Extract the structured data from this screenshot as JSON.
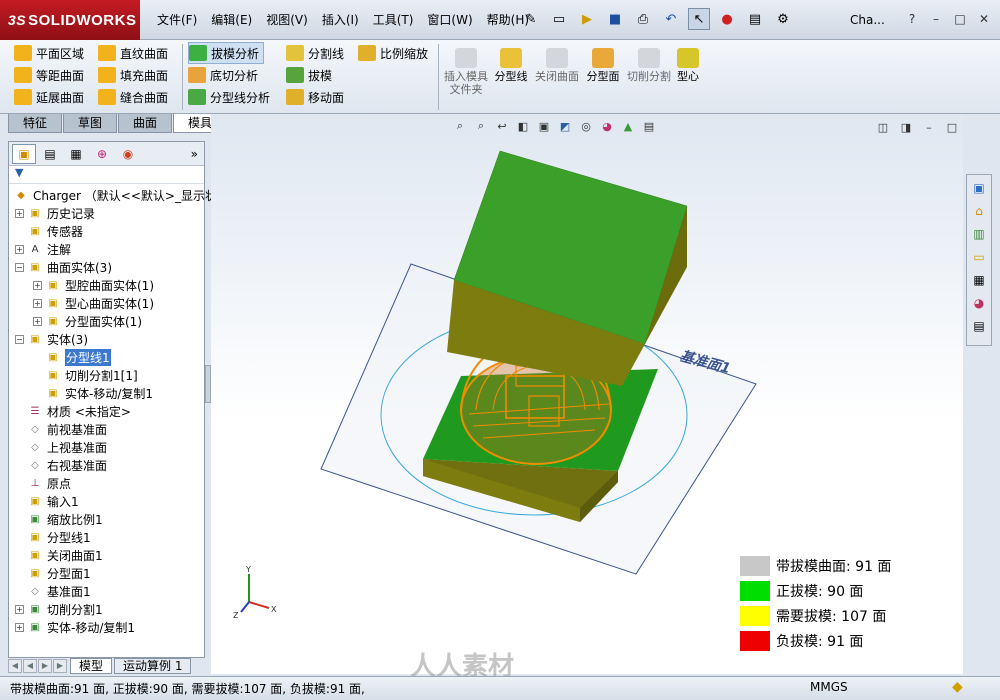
{
  "app": {
    "logo_prefix": "3S",
    "logo_text": "SOLIDWORKS",
    "doc_name": "Cha..."
  },
  "menus": [
    "文件(F)",
    "编辑(E)",
    "视图(V)",
    "插入(I)",
    "工具(T)",
    "窗口(W)",
    "帮助(H)"
  ],
  "window_controls": [
    "–",
    "□",
    "✕"
  ],
  "command_manager": {
    "group1": [
      "平面区域",
      "等距曲面",
      "延展曲面"
    ],
    "group2": [
      "直纹曲面",
      "填充曲面",
      "缝合曲面"
    ],
    "group3": [
      "拔模分析",
      "底切分析",
      "分型线分析"
    ],
    "group4": [
      "分割线",
      "拔模",
      "移动面"
    ],
    "group5": [
      "比例缩放"
    ],
    "big_buttons": [
      {
        "label": "插入模具文件夹",
        "enabled": false
      },
      {
        "label": "分型线",
        "enabled": true
      },
      {
        "label": "关闭曲面",
        "enabled": false
      },
      {
        "label": "分型面",
        "enabled": true
      },
      {
        "label": "切削分割",
        "enabled": false
      },
      {
        "label": "型心",
        "enabled": true
      }
    ]
  },
  "cmd_tabs": [
    "特征",
    "草图",
    "曲面",
    "模具工具"
  ],
  "feature_tree": {
    "expand_glyph": "»",
    "filter_icon": "filter-icon",
    "root": "Charger （默认<<默认>_显示状",
    "nodes": [
      {
        "label": "历史记录",
        "indent": 0,
        "exp": "+",
        "icon": "folder-history-icon"
      },
      {
        "label": "传感器",
        "indent": 0,
        "exp": "",
        "icon": "sensor-icon"
      },
      {
        "label": "注解",
        "indent": 0,
        "exp": "+",
        "icon": "annotation-icon"
      },
      {
        "label": "曲面实体(3)",
        "indent": 0,
        "exp": "−",
        "icon": "surface-bodies-icon"
      },
      {
        "label": "型腔曲面实体(1)",
        "indent": 1,
        "exp": "+",
        "icon": "surface-body-icon"
      },
      {
        "label": "型心曲面实体(1)",
        "indent": 1,
        "exp": "+",
        "icon": "surface-body-icon"
      },
      {
        "label": "分型面实体(1)",
        "indent": 1,
        "exp": "+",
        "icon": "surface-body-icon"
      },
      {
        "label": "实体(3)",
        "indent": 0,
        "exp": "−",
        "icon": "solid-bodies-icon"
      },
      {
        "label": "分型线1",
        "indent": 1,
        "exp": "",
        "icon": "solid-body-icon",
        "selected": true
      },
      {
        "label": "切削分割1[1]",
        "indent": 1,
        "exp": "",
        "icon": "solid-body-icon"
      },
      {
        "label": "实体-移动/复制1",
        "indent": 1,
        "exp": "",
        "icon": "solid-body-icon"
      },
      {
        "label": "材质 <未指定>",
        "indent": 0,
        "exp": "",
        "icon": "material-icon"
      },
      {
        "label": "前视基准面",
        "indent": 0,
        "exp": "",
        "icon": "plane-icon"
      },
      {
        "label": "上视基准面",
        "indent": 0,
        "exp": "",
        "icon": "plane-icon"
      },
      {
        "label": "右视基准面",
        "indent": 0,
        "exp": "",
        "icon": "plane-icon"
      },
      {
        "label": "原点",
        "indent": 0,
        "exp": "",
        "icon": "origin-icon"
      },
      {
        "label": "输入1",
        "indent": 0,
        "exp": "",
        "icon": "import-icon"
      },
      {
        "label": "缩放比例1",
        "indent": 0,
        "exp": "",
        "icon": "scale-icon"
      },
      {
        "label": "分型线1",
        "indent": 0,
        "exp": "",
        "icon": "parting-line-icon"
      },
      {
        "label": "关闭曲面1",
        "indent": 0,
        "exp": "",
        "icon": "shut-off-surface-icon"
      },
      {
        "label": "分型面1",
        "indent": 0,
        "exp": "",
        "icon": "parting-surface-icon"
      },
      {
        "label": "基准面1",
        "indent": 0,
        "exp": "",
        "icon": "plane-icon"
      },
      {
        "label": "切削分割1",
        "indent": 0,
        "exp": "+",
        "icon": "tooling-split-icon"
      },
      {
        "label": "实体-移动/复制1",
        "indent": 0,
        "exp": "+",
        "icon": "move-copy-icon"
      }
    ]
  },
  "model_tabs": [
    "模型",
    "运动算例 1"
  ],
  "graphics": {
    "plane_label": "基准面1",
    "colors": {
      "green": "#1f9a1f",
      "olive": "#7d7d0f",
      "orange": "#f08c00"
    }
  },
  "legend": [
    {
      "label": "带拔模曲面: 91 面",
      "color": "#c8c8c8"
    },
    {
      "label": "正拔模: 90 面",
      "color": "#00dd00"
    },
    {
      "label": "需要拔模: 107 面",
      "color": "#ffff00"
    },
    {
      "label": "负拔模: 91 面",
      "color": "#ee0000"
    }
  ],
  "status": {
    "text": "带拔模曲面:91 面, 正拔模:90 面, 需要拔模:107 面, 负拔模:91 面,",
    "units": "MMGS"
  },
  "watermark": "人人素材"
}
